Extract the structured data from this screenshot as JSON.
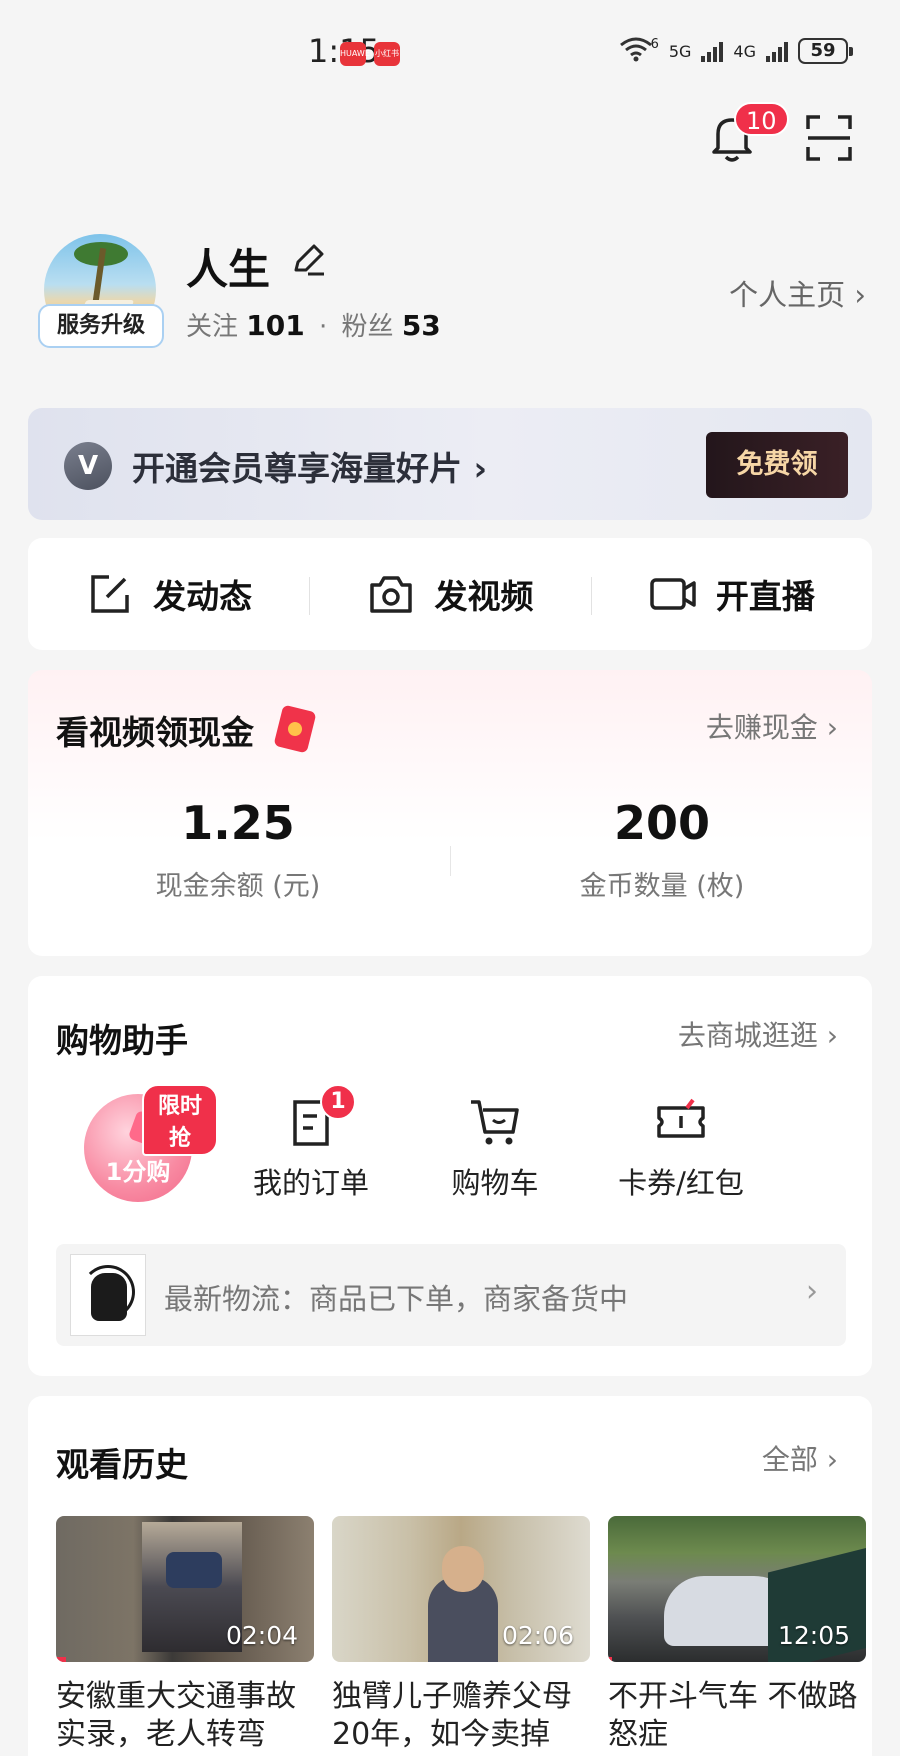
{
  "status_bar": {
    "time": "1:15",
    "app_badges": [
      "HUAWEI",
      "小红书"
    ],
    "network_1": "6",
    "network_2": "5G",
    "network_3": "4G",
    "battery": "59"
  },
  "top_bar": {
    "notification_count": "10"
  },
  "profile": {
    "username": "人生",
    "upgrade_label": "服务升级",
    "follow_label": "关注",
    "follow_count": "101",
    "separator": "·",
    "fans_label": "粉丝",
    "fans_count": "53",
    "home_link": "个人主页 ›"
  },
  "vip_banner": {
    "logo": "V",
    "text": "开通会员尊享海量好片 ›",
    "button": "免费领"
  },
  "actions": [
    {
      "label": "发动态",
      "icon": "edit-post-icon"
    },
    {
      "label": "发视频",
      "icon": "camera-icon"
    },
    {
      "label": "开直播",
      "icon": "video-camera-icon"
    }
  ],
  "cash": {
    "title": "看视频领现金",
    "link": "去赚现金 ›",
    "balance": "1.25",
    "balance_label": "现金余额 (元)",
    "coins": "200",
    "coins_label": "金币数量 (枚)"
  },
  "shopping": {
    "title": "购物助手",
    "link": "去商城逛逛 ›",
    "flash_badge": "限时抢",
    "flash_label": "1分购",
    "items": [
      {
        "label": "我的订单",
        "icon": "order-icon",
        "badge": "1"
      },
      {
        "label": "购物车",
        "icon": "cart-icon"
      },
      {
        "label": "卡券/红包",
        "icon": "coupon-icon"
      }
    ],
    "logistics": "最新物流：商品已下单，商家备货中",
    "logistics_chevron": "›"
  },
  "history": {
    "title": "观看历史",
    "link": "全部 ›",
    "videos": [
      {
        "duration": "02:04",
        "title": "安徽重大交通事故实录，老人转弯"
      },
      {
        "duration": "02:06",
        "title": "独臂儿子赡养父母20年，如今卖掉"
      },
      {
        "duration": "12:05",
        "title": "不开斗气车 不做路怒症"
      }
    ]
  },
  "colors": {
    "accent_red": "#f0304a",
    "vip_gold": "#f6d6a6"
  }
}
